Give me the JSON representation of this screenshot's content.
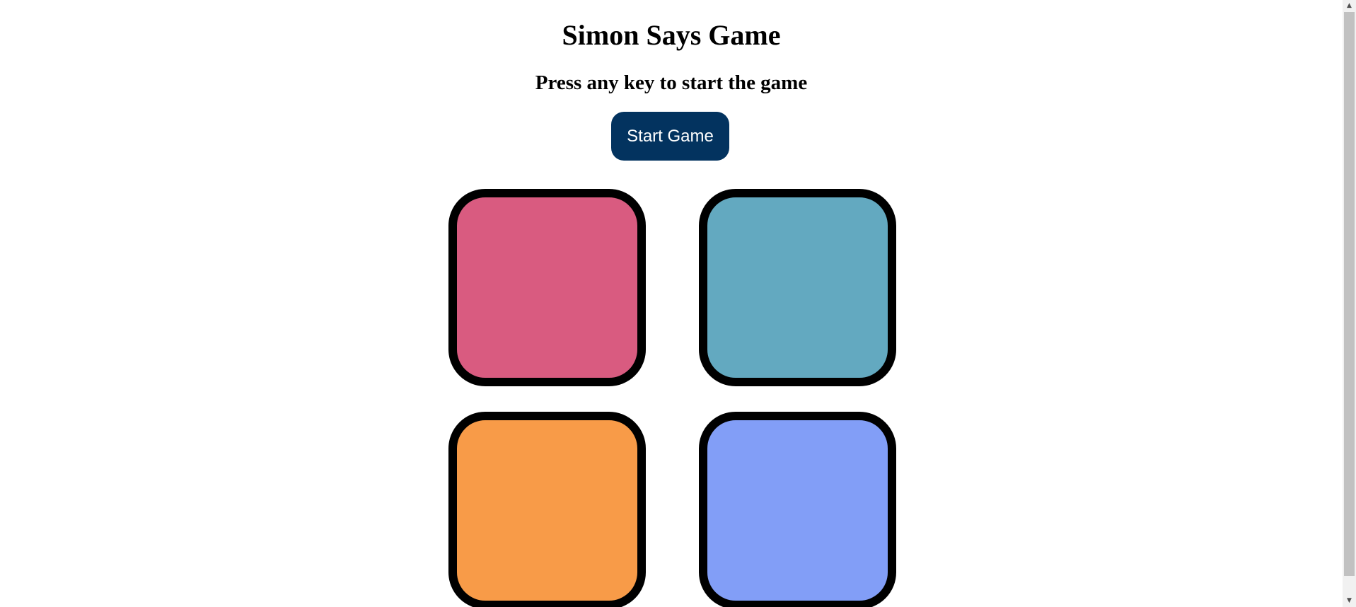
{
  "game": {
    "title": "Simon Says Game",
    "status": "Press any key to start the game",
    "start_button_label": "Start Game",
    "start_button_color": "#03335f",
    "start_button_text_color": "#ffffff",
    "pads": [
      {
        "color_name": "red",
        "color": "#d95b80"
      },
      {
        "color_name": "teal",
        "color": "#63a9c0"
      },
      {
        "color_name": "orange",
        "color": "#f89b48"
      },
      {
        "color_name": "blue",
        "color": "#829ef7"
      }
    ],
    "pad_border_color": "#000000"
  },
  "scrollbar": {
    "up_arrow_icon": "triangle-up",
    "down_arrow_icon": "triangle-down"
  }
}
